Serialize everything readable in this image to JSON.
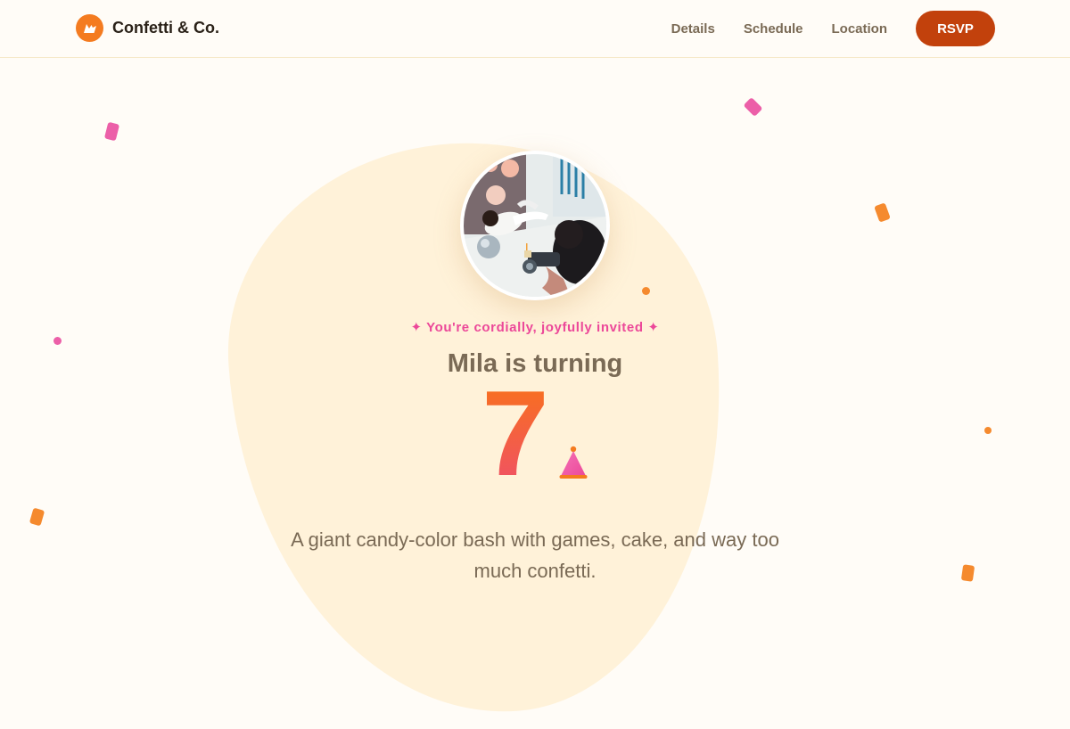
{
  "brand": {
    "name": "Confetti & Co.",
    "logo_icon": "party-sparkle-icon",
    "accent": "#f47b20"
  },
  "nav": {
    "links": [
      "Details",
      "Schedule",
      "Location"
    ],
    "cta_label": "RSVP",
    "cta_color": "#c2410c"
  },
  "hero": {
    "tagline": "✦ You're cordially, joyfully invited ✦",
    "heading": "Mila is turning",
    "age": "7",
    "age_gradient": [
      "#f97316",
      "#ef4f6a"
    ],
    "hat_icon": "party-hat-icon",
    "description": "A giant candy-color bash with games, cake, and way too much confetti.",
    "photo_alt": "Party photo shoot with balloons"
  },
  "colors": {
    "background": "#fffcf7",
    "blob": "#fff2d9",
    "pink": "#ec4899",
    "orange": "#f47b20",
    "text_muted": "#7a6a55"
  }
}
